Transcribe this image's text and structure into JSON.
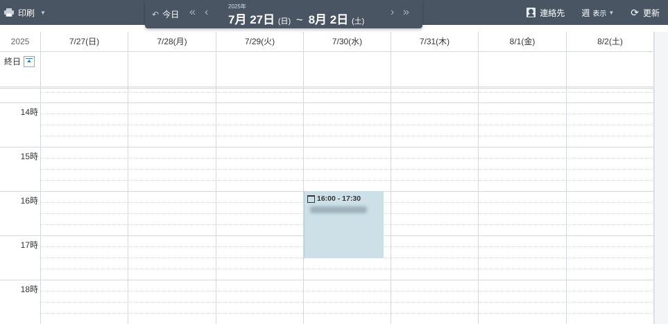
{
  "toolbar": {
    "print_label": "印刷",
    "contacts_label": "連絡先",
    "view_label": "週",
    "view_sub_label": "表示",
    "refresh_label": "更新"
  },
  "nav": {
    "today_label": "今日",
    "year_label": "2025年",
    "start_month": "7月",
    "start_day": "27日",
    "start_dow": "(日)",
    "tilde": "~",
    "end_month": "8月",
    "end_day": "2日",
    "end_dow": "(土)"
  },
  "calendar": {
    "year": "2025",
    "allday_label": "終日",
    "days": [
      "7/27(日)",
      "7/28(月)",
      "7/29(火)",
      "7/30(水)",
      "7/31(木)",
      "8/1(金)",
      "8/2(土)"
    ],
    "hours": [
      "14時",
      "15時",
      "16時",
      "17時",
      "18時"
    ]
  },
  "event": {
    "time": "16:00 - 17:30",
    "day": "7/30(水)"
  },
  "colors": {
    "toolbar_bg": "#4a5563",
    "event_bg": "#cde0e8",
    "grid_line": "#d4d8dc"
  }
}
